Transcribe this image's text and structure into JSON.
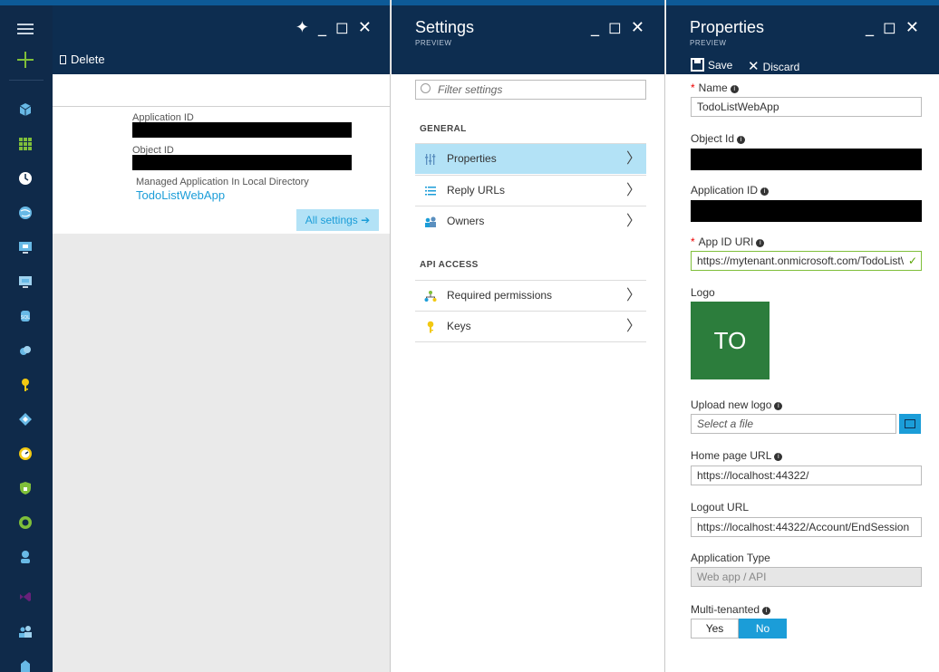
{
  "blade1": {
    "delete_label": "Delete",
    "app_id_label": "Application ID",
    "object_id_label": "Object ID",
    "managed_label": "Managed Application In Local Directory",
    "app_link": "TodoListWebApp",
    "all_settings": "All settings ➔"
  },
  "settings": {
    "title": "Settings",
    "subtitle": "PREVIEW",
    "filter_placeholder": "Filter settings",
    "general": "GENERAL",
    "api_access": "API ACCESS",
    "items": [
      {
        "label": "Properties",
        "icon": "properties-icon"
      },
      {
        "label": "Reply URLs",
        "icon": "list-icon"
      },
      {
        "label": "Owners",
        "icon": "users-icon"
      },
      {
        "label": "Required permissions",
        "icon": "hierarchy-icon"
      },
      {
        "label": "Keys",
        "icon": "key-icon"
      }
    ],
    "chevron": "〉"
  },
  "properties": {
    "title": "Properties",
    "subtitle": "PREVIEW",
    "save": "Save",
    "discard": "Discard",
    "name_label": "Name",
    "name_value": "TodoListWebApp",
    "object_id_label": "Object Id",
    "application_id_label": "Application ID",
    "app_id_uri_label": "App ID URI",
    "app_id_uri_value": "https://mytenant.onmicrosoft.com/TodoList\\",
    "logo_label": "Logo",
    "logo_text": "TO",
    "upload_label": "Upload new logo",
    "upload_placeholder": "Select a file",
    "homepage_label": "Home page URL",
    "homepage_value": "https://localhost:44322/",
    "logout_label": "Logout URL",
    "logout_value": "https://localhost:44322/Account/EndSession",
    "apptype_label": "Application Type",
    "apptype_value": "Web app / API",
    "multitenant_label": "Multi-tenanted",
    "yes": "Yes",
    "no": "No"
  },
  "colors": {
    "header": "#0d2d50",
    "accent": "#1b9dd8",
    "selected": "#b3e2f6",
    "logo": "#2c7d3c"
  }
}
